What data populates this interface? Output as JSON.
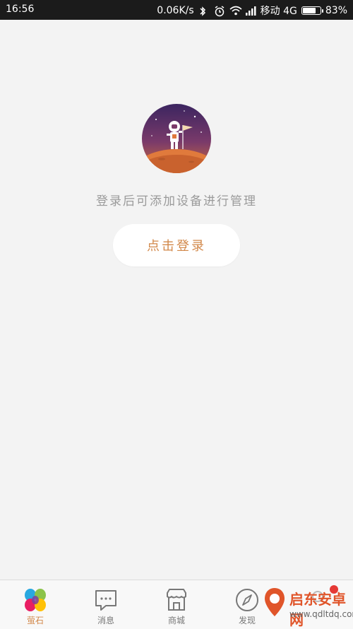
{
  "status_bar": {
    "time": "16:56",
    "network_speed": "0.06K/s",
    "carrier": "移动 4G",
    "battery_percent": "83%",
    "battery_level": 0.83,
    "icons": [
      "bluetooth-icon",
      "alarm-icon",
      "wifi-icon",
      "signal-icon",
      "battery-icon"
    ]
  },
  "main": {
    "hint_text": "登录后可添加设备进行管理",
    "login_button": "点击登录",
    "accent_color": "#d2884a"
  },
  "tabbar": {
    "items": [
      {
        "label": "萤石",
        "icon": "ezviz-logo-icon",
        "active": true
      },
      {
        "label": "消息",
        "icon": "message-icon",
        "active": false
      },
      {
        "label": "商城",
        "icon": "store-icon",
        "active": false
      },
      {
        "label": "发现",
        "icon": "compass-icon",
        "active": false
      },
      {
        "label": "",
        "icon": "profile-icon",
        "active": false
      }
    ],
    "badge_color": "#e53935"
  },
  "watermark": {
    "title": "启东安卓网",
    "url": "www.qdltdq.com"
  }
}
